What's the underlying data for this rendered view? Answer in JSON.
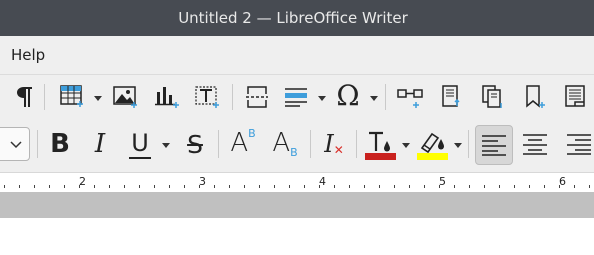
{
  "window": {
    "title": "Untitled 2 — LibreOffice Writer"
  },
  "menu": {
    "items": [
      "Help"
    ]
  },
  "toolbar_standard": {
    "icons": [
      "formatting-marks-icon",
      "insert-table-icon",
      "insert-image-icon",
      "insert-chart-icon",
      "insert-textbox-icon",
      "insert-page-break-icon",
      "insert-field-icon",
      "insert-special-character-icon",
      "insert-hyperlink-icon",
      "insert-footnote-icon",
      "insert-endnote-icon",
      "insert-bookmark-icon",
      "insert-cross-reference-icon"
    ],
    "special_char_glyph": "Ω"
  },
  "toolbar_formatting": {
    "bold_label": "B",
    "italic_label": "I",
    "underline_label": "U",
    "strikethrough_label": "S",
    "superscript_label": "A",
    "superscript_mark": "B",
    "subscript_label": "A",
    "subscript_mark": "B",
    "clear_formatting_label": "I",
    "font_color_label": "T",
    "font_color": "#c9211e",
    "highlight_color": "#ffff00",
    "accent_blue": "#3d9ddb"
  },
  "ruler": {
    "numbers": [
      "2",
      "3",
      "4",
      "5",
      "6"
    ]
  }
}
